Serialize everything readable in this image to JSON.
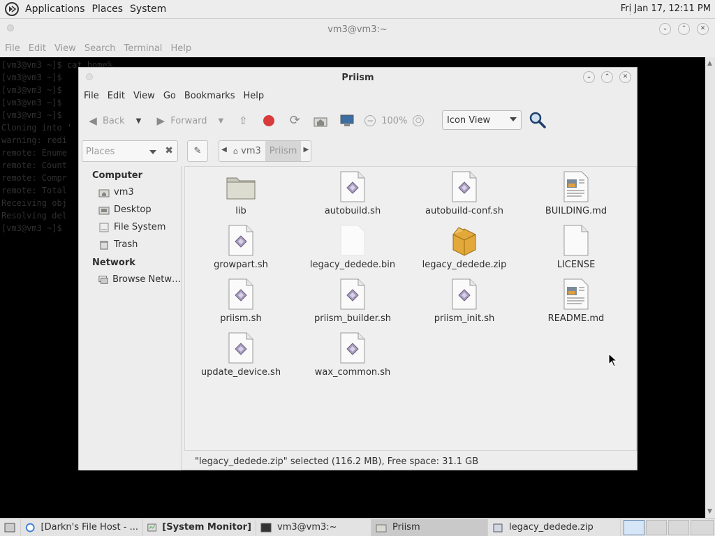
{
  "top_panel": {
    "menus": [
      "Applications",
      "Places",
      "System"
    ],
    "clock": "Fri Jan 17, 12:11 PM"
  },
  "terminal": {
    "title": "vm3@vm3:~",
    "menus": [
      "File",
      "Edit",
      "View",
      "Search",
      "Terminal",
      "Help"
    ],
    "lines": [
      "[vm3@vm3 ~]$ cat home%",
      "[vm3@vm3 ~]$ ",
      "[vm3@vm3 ~]$ ",
      "[vm3@vm3 ~]$ ",
      "[vm3@vm3 ~]$ ",
      "Cloning into '",
      "warning: redi",
      "remote: Enume",
      "remote: Count",
      "remote: Compr",
      "remote: Total",
      "Receiving obj",
      "Resolving del",
      "[vm3@vm3 ~]$ "
    ]
  },
  "file_manager": {
    "title": "Priism",
    "menus": [
      "File",
      "Edit",
      "View",
      "Go",
      "Bookmarks",
      "Help"
    ],
    "toolbar": {
      "back": "Back",
      "forward": "Forward",
      "zoom": "100%",
      "view_mode": "Icon View"
    },
    "places_placeholder": "Places",
    "breadcrumbs": [
      "vm3",
      "Priism"
    ],
    "sidebar": {
      "computer_heading": "Computer",
      "computer_items": [
        "vm3",
        "Desktop",
        "File System",
        "Trash"
      ],
      "network_heading": "Network",
      "network_items": [
        "Browse Netw…"
      ]
    },
    "files": [
      {
        "name": "lib",
        "type": "folder"
      },
      {
        "name": "autobuild.sh",
        "type": "script"
      },
      {
        "name": "autobuild-conf.sh",
        "type": "script"
      },
      {
        "name": "BUILDING.md",
        "type": "doc"
      },
      {
        "name": "growpart.sh",
        "type": "script"
      },
      {
        "name": "legacy_dedede.bin",
        "type": "blank"
      },
      {
        "name": "legacy_dedede.zip",
        "type": "archive"
      },
      {
        "name": "LICENSE",
        "type": "plain"
      },
      {
        "name": "priism.sh",
        "type": "script"
      },
      {
        "name": "priism_builder.sh",
        "type": "script"
      },
      {
        "name": "priism_init.sh",
        "type": "script"
      },
      {
        "name": "README.md",
        "type": "doc"
      },
      {
        "name": "update_device.sh",
        "type": "script"
      },
      {
        "name": "wax_common.sh",
        "type": "script"
      }
    ],
    "status": "\"legacy_dedede.zip\" selected (116.2 MB), Free space: 31.1 GB"
  },
  "taskbar": {
    "tasks": [
      {
        "label": "[Darkn's File Host - ...",
        "icon": "browser-icon"
      },
      {
        "label": "[System Monitor]",
        "icon": "monitor-icon"
      },
      {
        "label": "vm3@vm3:~",
        "icon": "terminal-icon"
      },
      {
        "label": "Priism",
        "icon": "folder-icon"
      },
      {
        "label": "legacy_dedede.zip",
        "icon": "archive-icon"
      }
    ]
  }
}
